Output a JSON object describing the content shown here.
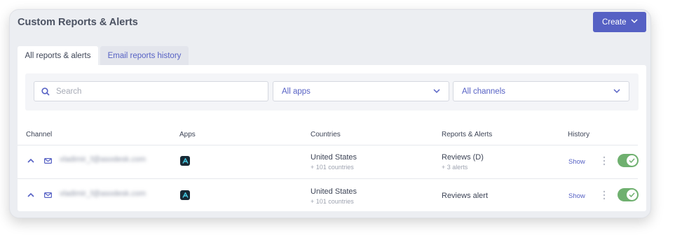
{
  "header": {
    "title": "Custom Reports & Alerts",
    "create_label": "Create"
  },
  "tabs": [
    {
      "label": "All reports & alerts",
      "active": true
    },
    {
      "label": "Email reports history",
      "active": false
    }
  ],
  "filters": {
    "search_placeholder": "Search",
    "apps_value": "All apps",
    "channels_value": "All channels"
  },
  "columns": [
    "Channel",
    "Apps",
    "Countries",
    "Reports & Alerts",
    "History"
  ],
  "rows": [
    {
      "channel_icon": "mail-icon",
      "email": "vladimir_f@asodesk.com",
      "app_icon": "app-logo-icon",
      "country": "United States",
      "countries_more": "+ 101 countries",
      "report": "Reviews (D)",
      "alerts_more": "+ 3 alerts",
      "history_label": "Show",
      "enabled": true
    },
    {
      "channel_icon": "mail-icon",
      "email": "vladimir_f@asodesk.com",
      "app_icon": "app-logo-icon",
      "country": "United States",
      "countries_more": "+ 101 countries",
      "report": "Reviews alert",
      "alerts_more": "",
      "history_label": "Show",
      "enabled": true
    }
  ],
  "colors": {
    "accent": "#5661c4",
    "toggle_on": "#6fb06f",
    "card_bg": "#eceef2",
    "app_icon_bg": "#182a35"
  }
}
